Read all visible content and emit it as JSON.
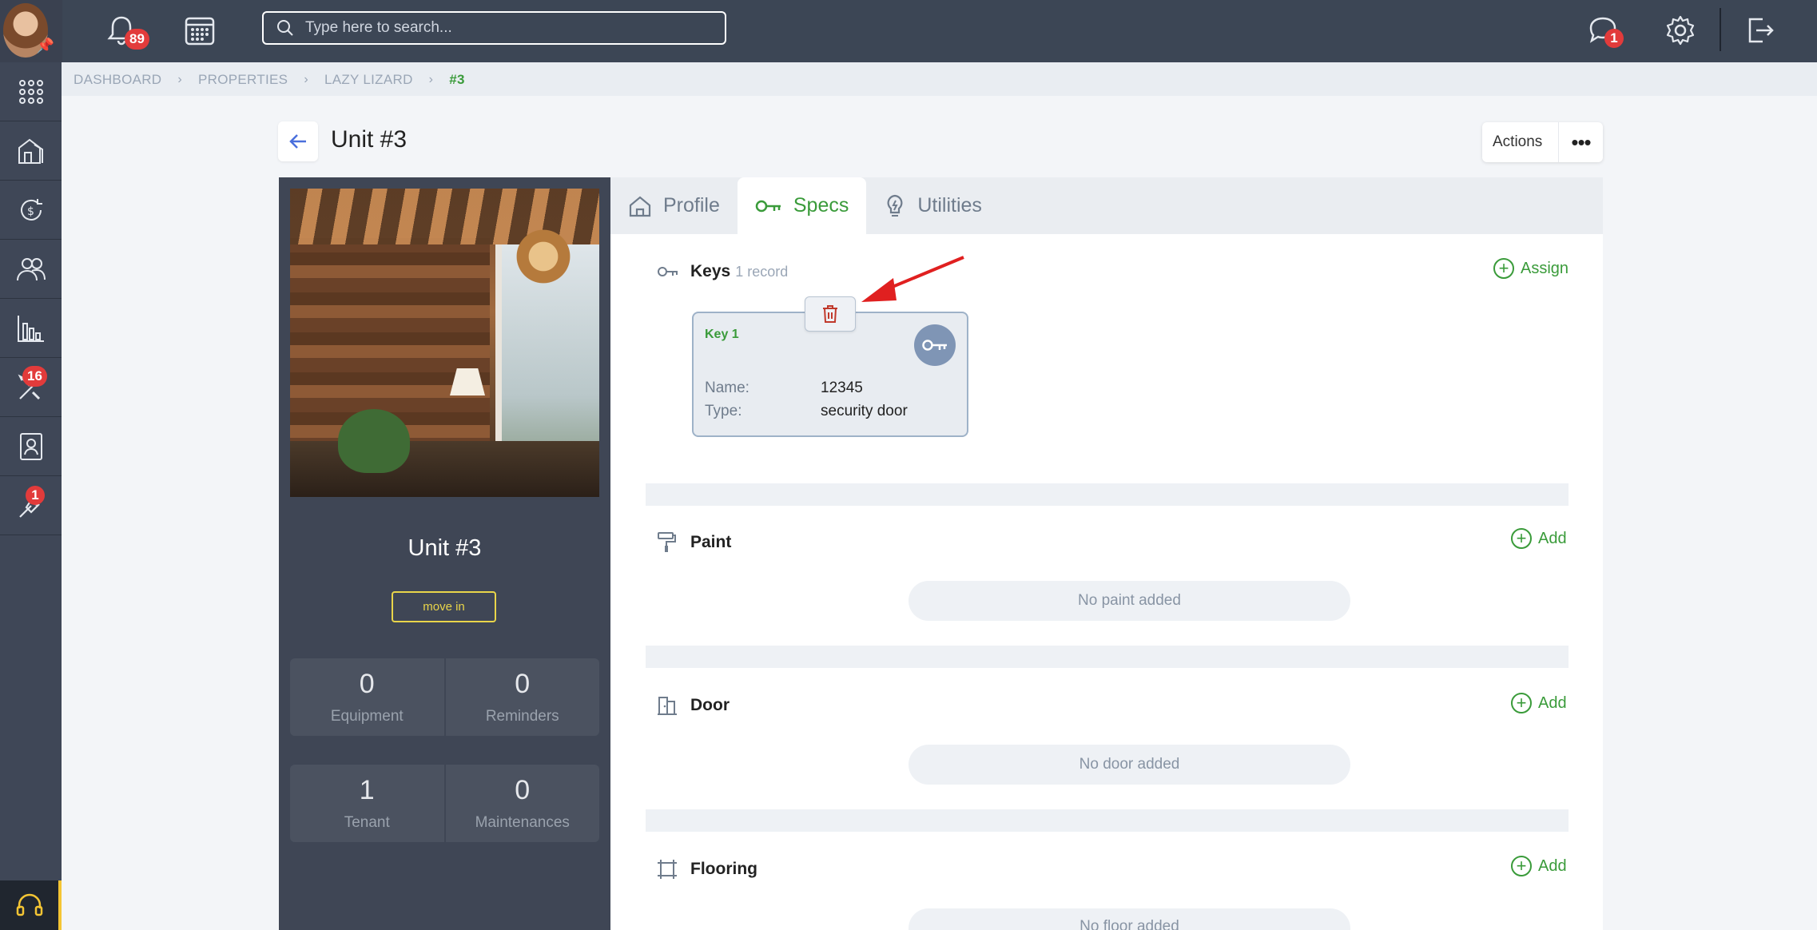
{
  "topbar": {
    "notifications_count": "89",
    "search_placeholder": "Type here to search...",
    "messages_count": "1"
  },
  "sidebar": {
    "items": [
      {
        "icon": "apps-grid-icon"
      },
      {
        "icon": "properties-icon"
      },
      {
        "icon": "finance-icon"
      },
      {
        "icon": "people-icon"
      },
      {
        "icon": "reports-icon"
      },
      {
        "icon": "maintenance-icon",
        "badge": "16"
      },
      {
        "icon": "contacts-icon"
      },
      {
        "icon": "tools-icon",
        "badge": "1"
      }
    ],
    "support_icon": "headset-icon"
  },
  "breadcrumb": [
    "DASHBOARD",
    "PROPERTIES",
    "LAZY LIZARD",
    "#3"
  ],
  "page": {
    "title": "Unit #3",
    "actions_label": "Actions"
  },
  "unit": {
    "name": "Unit #3",
    "status_button": "move in",
    "stats": [
      {
        "value": "0",
        "label": "Equipment"
      },
      {
        "value": "0",
        "label": "Reminders"
      },
      {
        "value": "1",
        "label": "Tenant"
      },
      {
        "value": "0",
        "label": "Maintenances"
      }
    ]
  },
  "tabs": [
    {
      "label": "Profile",
      "active": false
    },
    {
      "label": "Specs",
      "active": true
    },
    {
      "label": "Utilities",
      "active": false
    }
  ],
  "sections": {
    "keys": {
      "title": "Keys",
      "count": "1 record",
      "action": "Assign",
      "card": {
        "title": "Key 1",
        "name_label": "Name:",
        "name_value": "12345",
        "type_label": "Type:",
        "type_value": "security door"
      }
    },
    "paint": {
      "title": "Paint",
      "action": "Add",
      "empty": "No paint added"
    },
    "door": {
      "title": "Door",
      "action": "Add",
      "empty": "No door added"
    },
    "flooring": {
      "title": "Flooring",
      "action": "Add",
      "empty": "No floor added"
    }
  },
  "colors": {
    "accent_green": "#3a9b3a",
    "topbar": "#3c4655",
    "badge_red": "#e23b3b",
    "move_in_yellow": "#e9d54a",
    "annotation_arrow": "#e02020"
  }
}
